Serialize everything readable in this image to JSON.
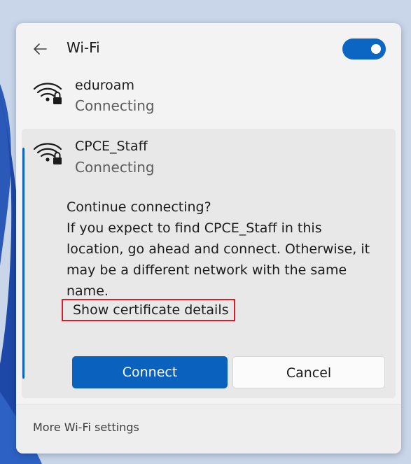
{
  "header": {
    "title": "Wi-Fi",
    "back_icon": "arrow-left-icon",
    "toggle_state": "on",
    "accent_color": "#0b66c3"
  },
  "networks": [
    {
      "name": "eduroam",
      "status": "Connecting",
      "icon": "wifi-secured-icon"
    },
    {
      "name": "CPCE_Staff",
      "status": "Connecting",
      "icon": "wifi-secured-icon",
      "expanded": true
    }
  ],
  "prompt": {
    "heading": "Continue connecting?",
    "line1": "If you expect to find CPCE_Staff in this",
    "line2": "location, go ahead and connect. Otherwise, it",
    "line3": "may be a different network with the same",
    "line4": "name.",
    "cert_link": "Show certificate details",
    "highlight_color": "#d3202c"
  },
  "buttons": {
    "connect": "Connect",
    "cancel": "Cancel"
  },
  "footer": {
    "link": "More Wi-Fi settings"
  }
}
